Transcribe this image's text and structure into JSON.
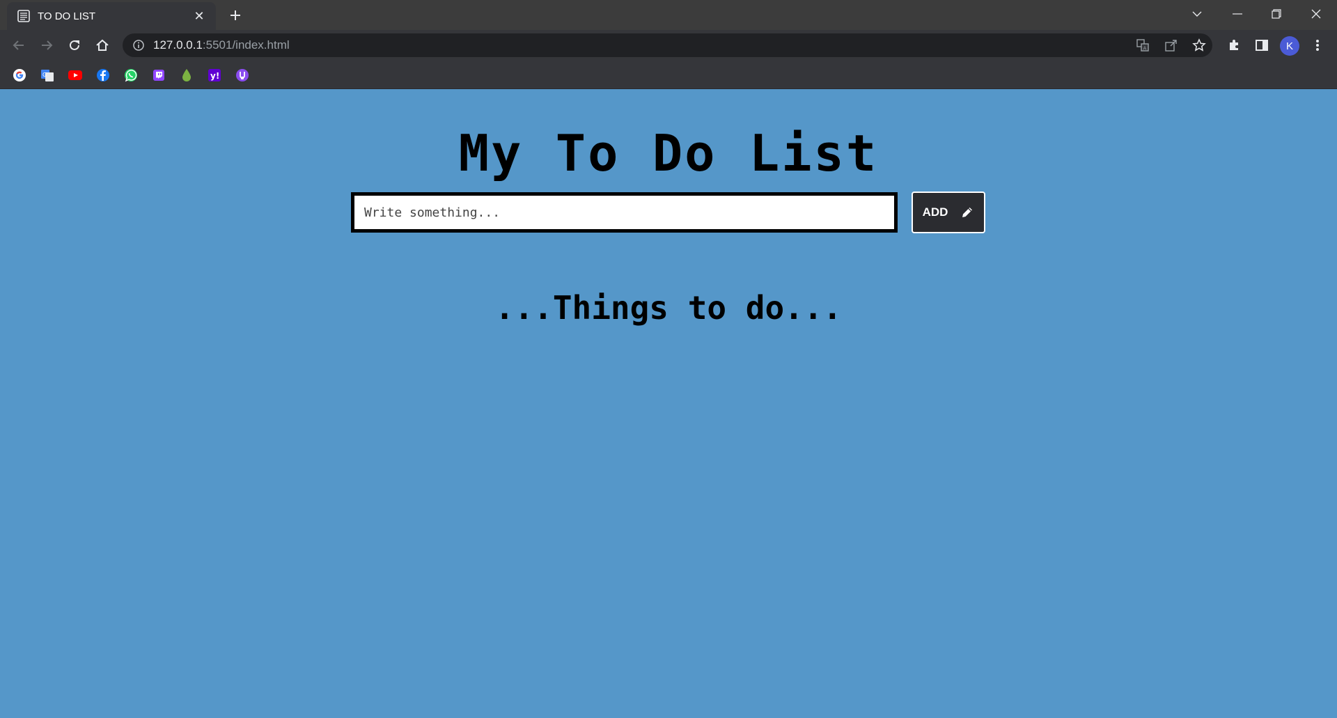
{
  "browser": {
    "tab": {
      "title": "TO DO LIST",
      "favicon_icon": "notepad-icon"
    },
    "new_tab_icon": "plus-icon",
    "window_controls": [
      "chevron-down-icon",
      "minimize-icon",
      "restore-icon",
      "close-icon"
    ],
    "address": {
      "host": "127.0.0.1",
      "rest": ":5501/index.html"
    },
    "bookmarks": [
      {
        "icon": "google-icon",
        "color": "#4285f4"
      },
      {
        "icon": "google-translate-icon",
        "color": "#4285f4"
      },
      {
        "icon": "youtube-icon",
        "color": "#ff0000"
      },
      {
        "icon": "facebook-icon",
        "color": "#1877f2"
      },
      {
        "icon": "whatsapp-icon",
        "color": "#25d366"
      },
      {
        "icon": "twitch-icon",
        "color": "#9146ff"
      },
      {
        "icon": "droplet-icon",
        "color": "#7cb342"
      },
      {
        "icon": "yahoo-icon",
        "color": "#6001d2"
      },
      {
        "icon": "proton-icon",
        "color": "#8a4cf0"
      }
    ],
    "profile_initial": "K"
  },
  "app": {
    "title": "My To Do List",
    "input_placeholder": "Write something...",
    "add_button_label": "ADD",
    "add_button_icon": "pencil-icon",
    "subtitle": "...Things to do...",
    "background_color": "#5597c9"
  }
}
